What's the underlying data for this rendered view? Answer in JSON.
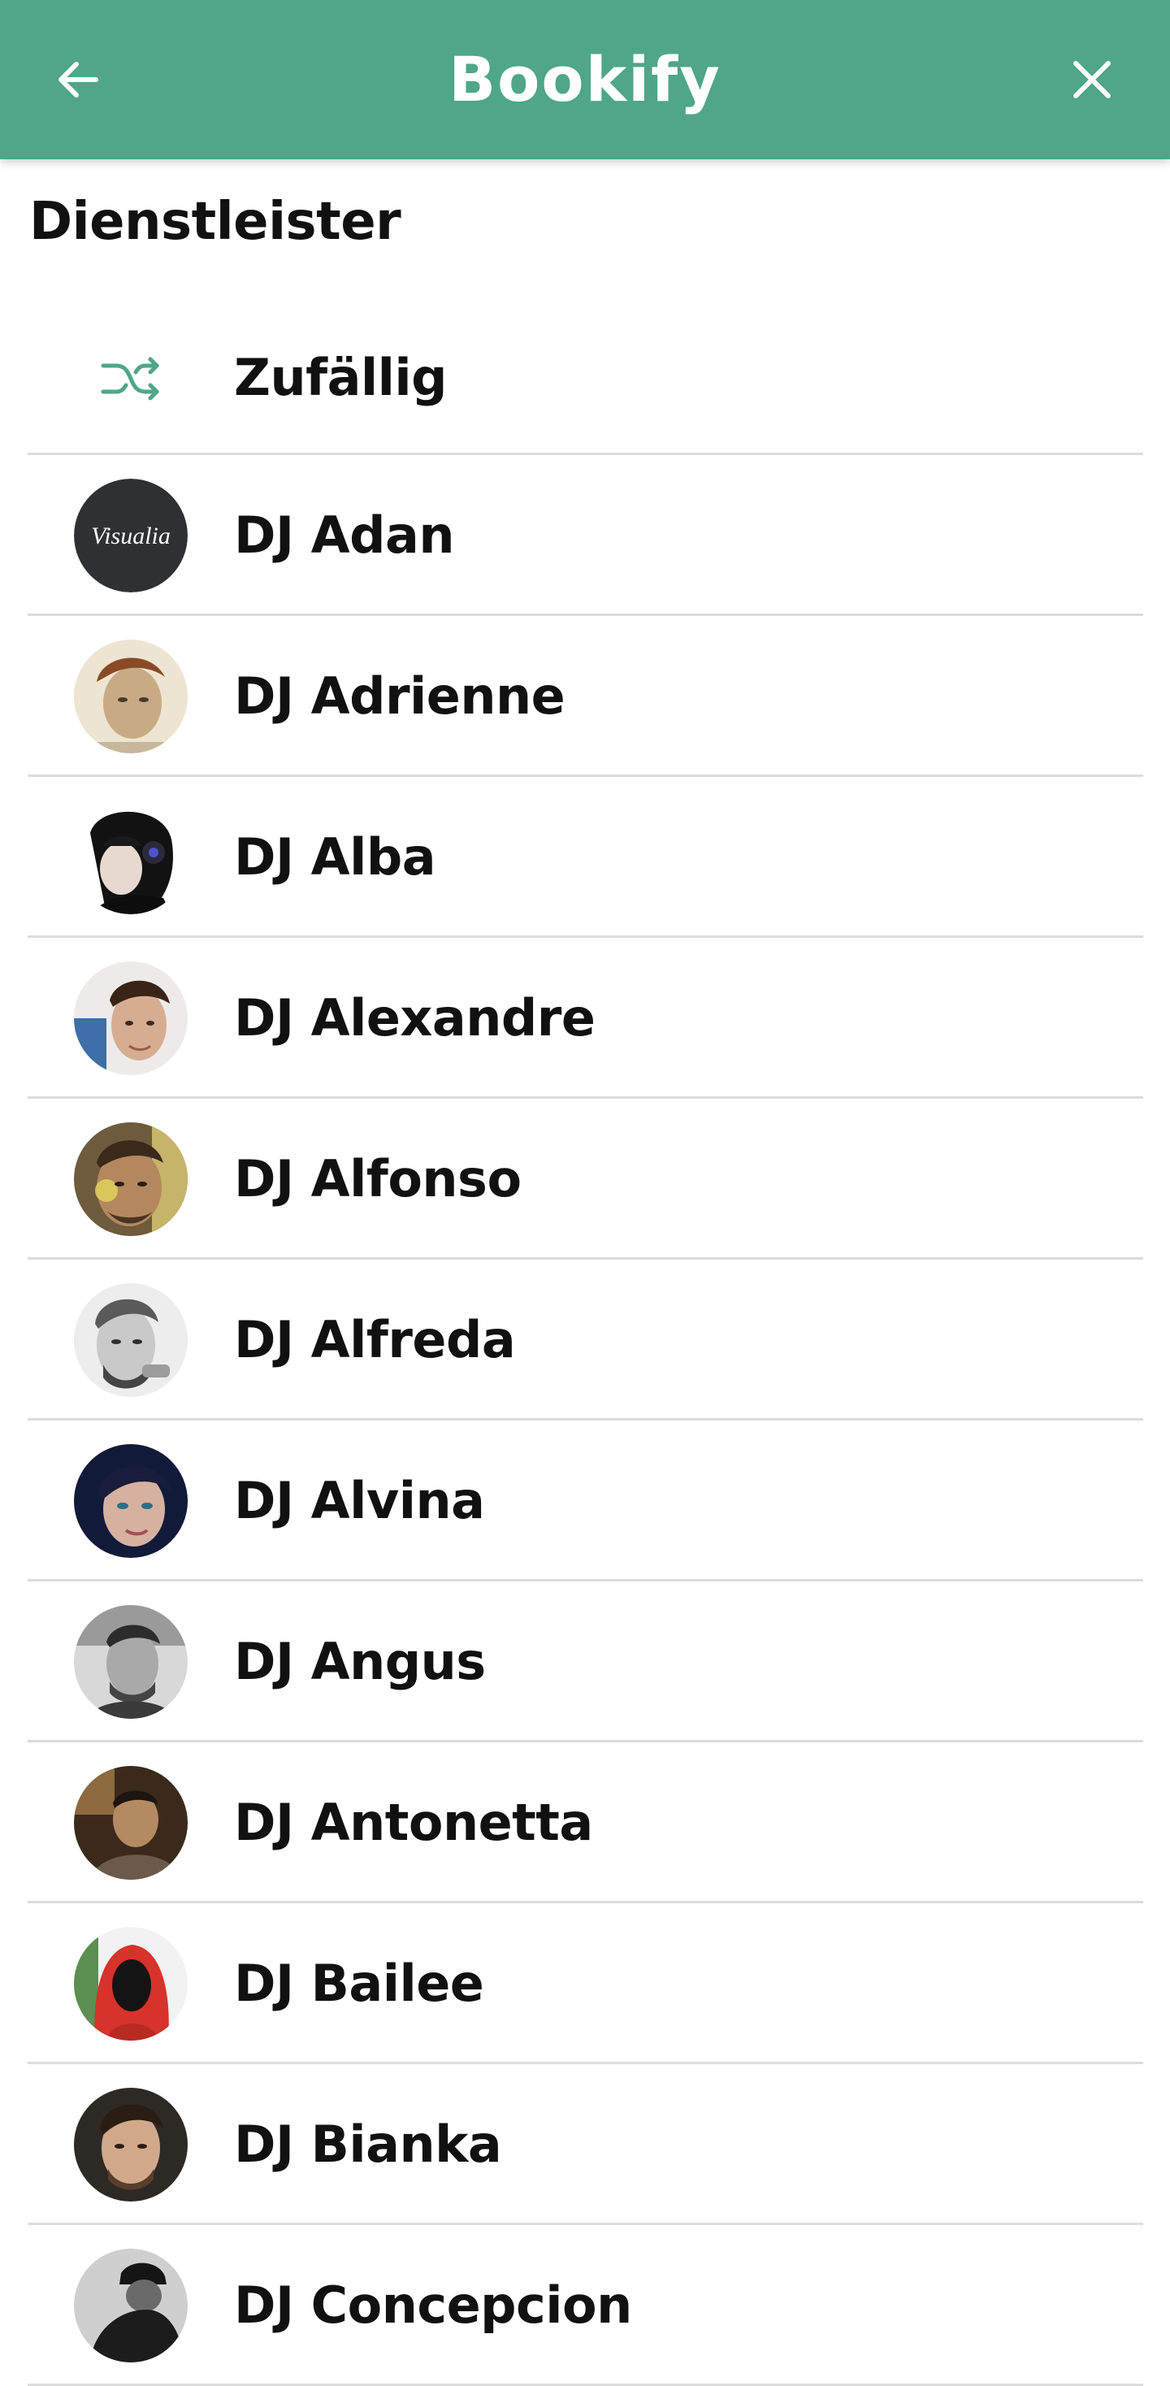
{
  "appbar": {
    "title": "Bookify",
    "background_color": "#4fa688",
    "back_icon": "arrow-left-icon",
    "close_icon": "close-icon"
  },
  "section": {
    "title": "Dienstleister"
  },
  "list": {
    "random": {
      "label": "Zufällig",
      "icon": "shuffle-icon",
      "icon_color": "#4fa688"
    },
    "providers": [
      {
        "label": "DJ Adan",
        "avatar_text": "Visualia"
      },
      {
        "label": "DJ Adrienne"
      },
      {
        "label": "DJ Alba"
      },
      {
        "label": "DJ Alexandre"
      },
      {
        "label": "DJ Alfonso"
      },
      {
        "label": "DJ Alfreda"
      },
      {
        "label": "DJ Alvina"
      },
      {
        "label": "DJ Angus"
      },
      {
        "label": "DJ Antonetta"
      },
      {
        "label": "DJ Bailee"
      },
      {
        "label": "DJ Bianka"
      },
      {
        "label": "DJ Concepcion"
      }
    ]
  }
}
